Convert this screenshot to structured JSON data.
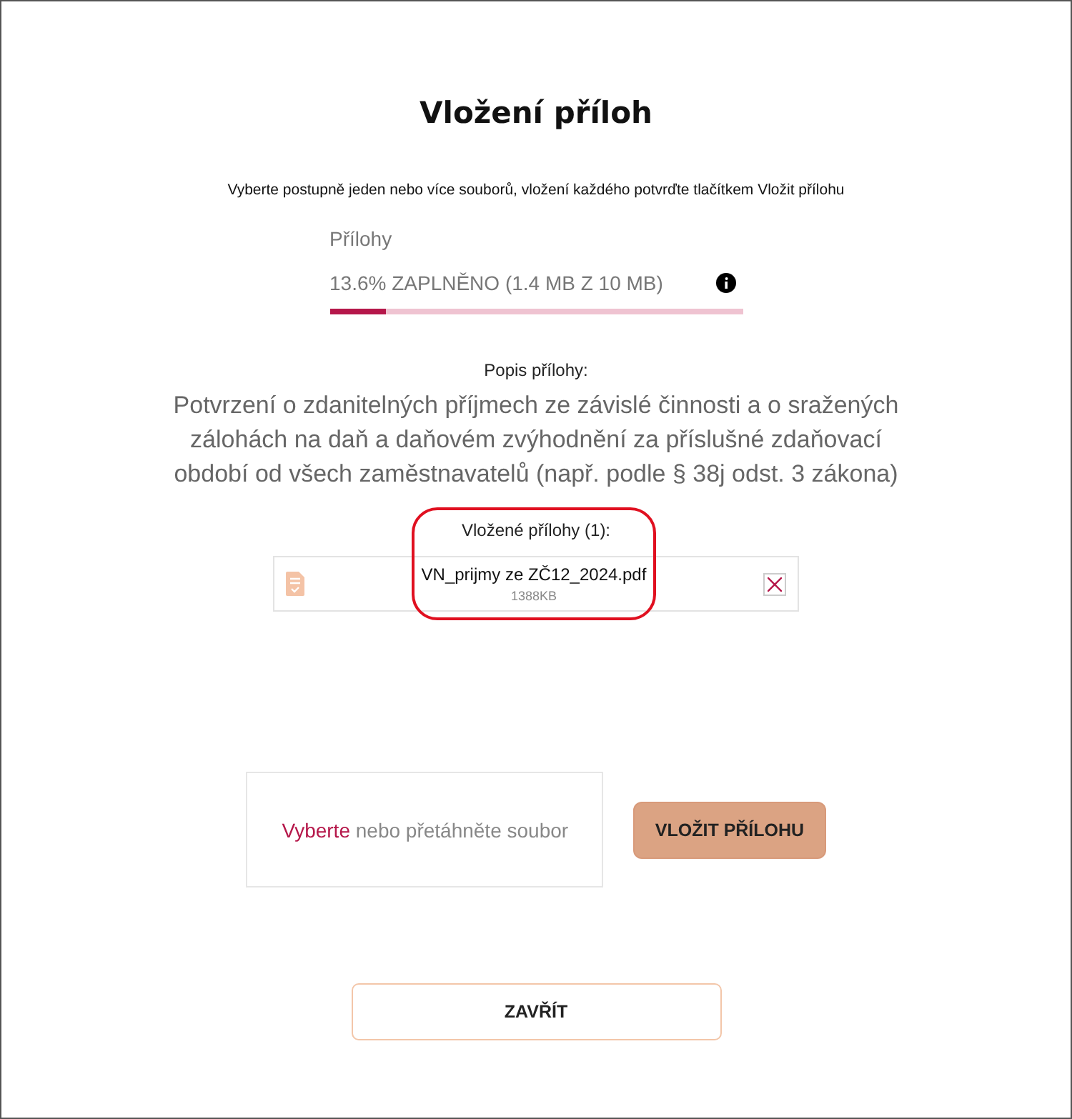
{
  "dialog": {
    "title": "Vložení příloh",
    "instruction": "Vyberte postupně jeden nebo více souborů, vložení každého potvrďte tlačítkem Vložit přílohu"
  },
  "storage": {
    "label": "Přílohy",
    "reading": "13.6% ZAPLNĚNO (1.4 MB Z 10 MB)",
    "level": 0.136
  },
  "description": {
    "label": "Popis přílohy:",
    "text": "Potvrzení o zdanitelných příjmech ze závislé činnosti a o sražených zálohách na daň a daňovém zvýhodnění za příslušné zdaňovací období od všech zaměstnavatelů (např. podle § 38j odst. 3 zákona)"
  },
  "attachments": {
    "heading": "Vložené přílohy (1):",
    "highlighted": true,
    "files": [
      {
        "name": "VN_prijmy ze ZČ12_2024.pdf",
        "size": "1388KB"
      }
    ]
  },
  "dropzone": {
    "link": "Vyberte",
    "text": "nebo přetáhněte soubor"
  },
  "buttons": {
    "insert": "VLOŽIT PŘÍLOHU",
    "close": "ZAVŘÍT"
  }
}
